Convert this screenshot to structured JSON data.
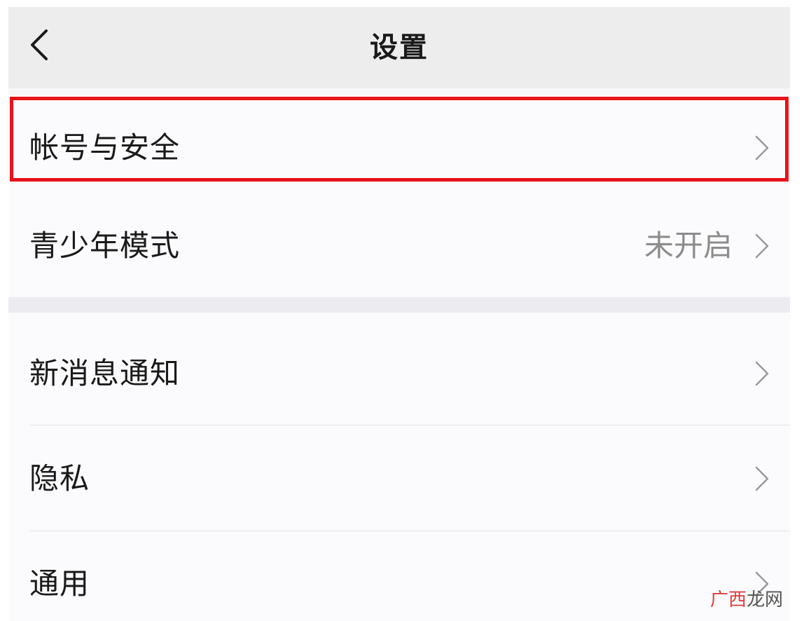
{
  "header": {
    "title": "设置",
    "back_icon": "chevron-left-icon"
  },
  "groups": [
    {
      "items": [
        {
          "label": "帐号与安全",
          "value": "",
          "highlighted": true
        },
        {
          "label": "青少年模式",
          "value": "未开启",
          "highlighted": false
        }
      ]
    },
    {
      "items": [
        {
          "label": "新消息通知",
          "value": ""
        },
        {
          "label": "隐私",
          "value": ""
        },
        {
          "label": "通用",
          "value": ""
        }
      ]
    }
  ],
  "highlight_color": "#e8131b",
  "watermark": {
    "part_a": "广西",
    "part_b": "龙网"
  }
}
